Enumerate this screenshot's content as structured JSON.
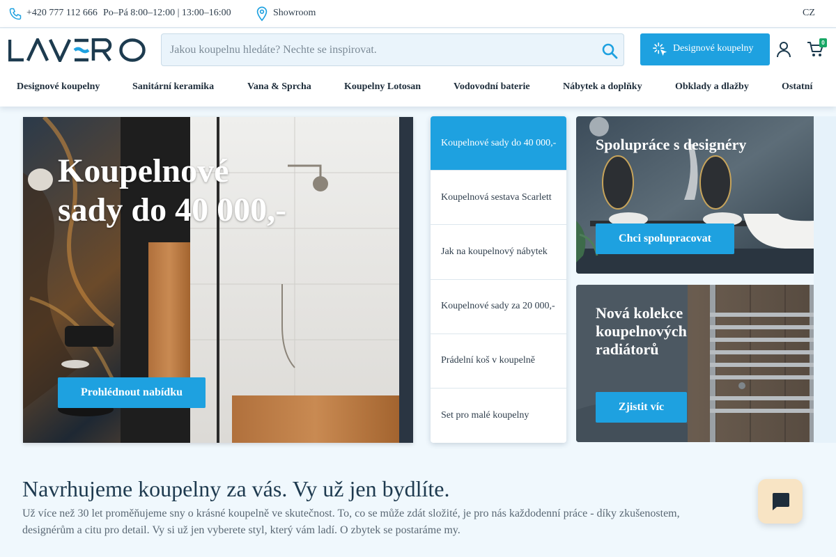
{
  "topbar": {
    "phone": "+420 777 112 666",
    "hours": "Po–Pá 8:00–12:00 | 13:00–16:00",
    "showroom": "Showroom",
    "language": "CZ"
  },
  "header": {
    "logo_text": "LAVERO",
    "search_placeholder": "Jakou koupelnu hledáte? Nechte se inspirovat.",
    "design_button": "Designové koupelny",
    "cart_count": "0"
  },
  "nav": [
    "Designové koupelny",
    "Sanitární keramika",
    "Vana & Sprcha",
    "Koupelny Lotosan",
    "Vodovodní baterie",
    "Nábytek a doplňky",
    "Obklady a dlažby",
    "Ostatní"
  ],
  "hero": {
    "title_line1": "Koupelnové",
    "title_line2": "sady do 40 000,-",
    "cta": "Prohlédnout nabídku"
  },
  "menu": [
    {
      "label": "Koupelnové sady do 40 000,-",
      "active": true
    },
    {
      "label": "Koupelnová sestava Scarlett",
      "active": false
    },
    {
      "label": "Jak na koupelnový nábytek",
      "active": false
    },
    {
      "label": "Koupelnové sady za 20 000,-",
      "active": false
    },
    {
      "label": "Prádelní koš v koupelně",
      "active": false
    },
    {
      "label": "Set pro malé koupelny",
      "active": false
    }
  ],
  "cards": {
    "designers": {
      "title": "Spolupráce s designéry",
      "cta": "Chci spolupracovat"
    },
    "radiators": {
      "title": "Nová kolekce koupelnových radiátorů",
      "cta": "Zjistit víc"
    }
  },
  "intro": {
    "title": "Navrhujeme koupelny za vás. Vy už jen bydlíte.",
    "text": "Už více než 30 let proměňujeme sny o krásné koupelně ve skutečnost. To, co se může zdát složité, je pro nás každodenní práce - díky zkušenostem, designérům a citu pro detail. Vy si už jen vyberete styl, který vám ladí. O zbytek se postaráme my."
  },
  "colors": {
    "accent": "#1ea1e0",
    "brand_dark": "#1d3b4f",
    "background": "#f0f8fd",
    "chat_bg": "#f8e4c4"
  },
  "icons": [
    "phone-icon",
    "location-pin-icon",
    "search-icon",
    "sparkle-icon",
    "user-icon",
    "cart-icon",
    "chat-icon"
  ]
}
